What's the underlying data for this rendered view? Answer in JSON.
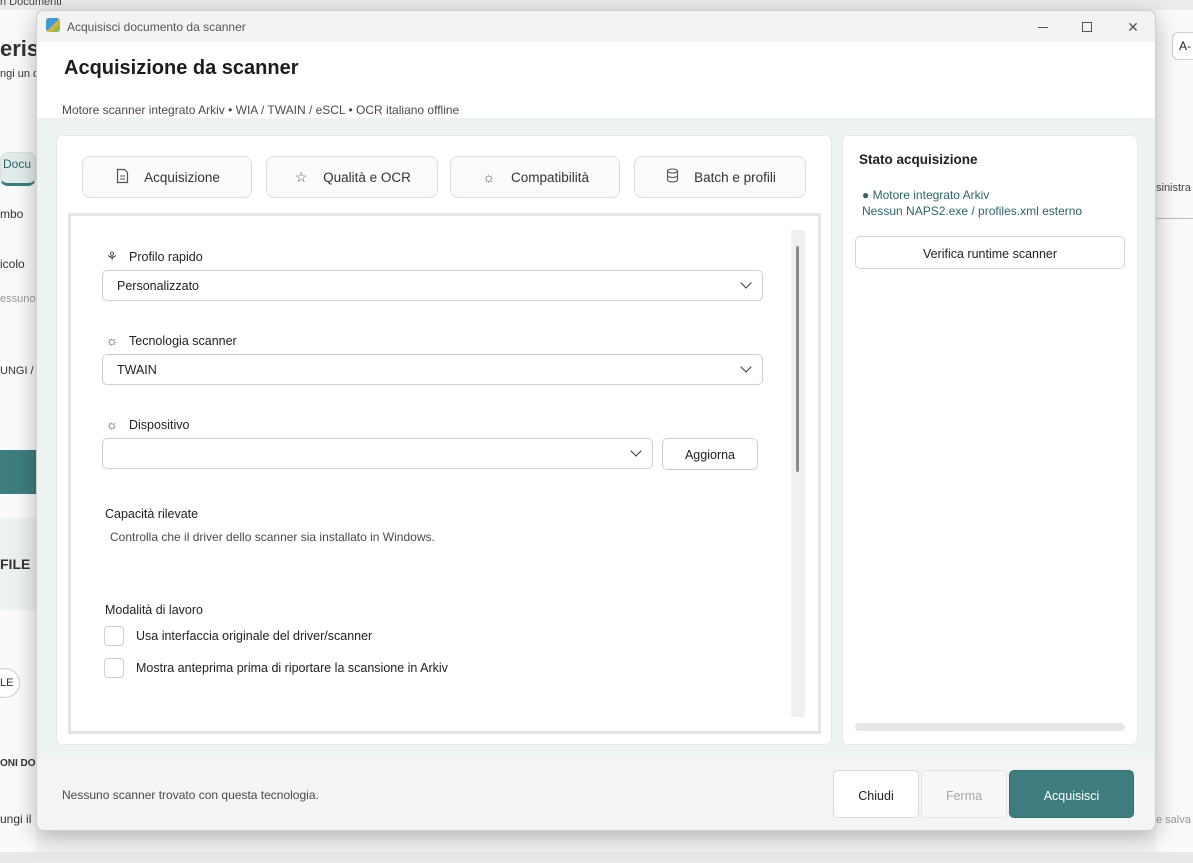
{
  "background": {
    "top_text": "ri Documenti",
    "left_fragments": [
      "eris",
      "ngi un d",
      "Docu",
      "mbo",
      "icolo",
      "essuno",
      "UNGI /",
      "FILE",
      "LE",
      "ONI DO",
      "ungi il"
    ],
    "right_fragments": [
      "A-",
      "sinistra",
      "e salva"
    ]
  },
  "window": {
    "title": "Acquisisci documento da scanner"
  },
  "header": {
    "title": "Acquisizione da scanner",
    "subtitle": "Motore scanner integrato Arkiv • WIA / TWAIN / eSCL • OCR italiano offline"
  },
  "tabs": [
    {
      "label": "Acquisizione",
      "icon": "document-icon"
    },
    {
      "label": "Qualità e OCR",
      "icon": "star-icon"
    },
    {
      "label": "Compatibilità",
      "icon": "sun-icon"
    },
    {
      "label": "Batch e profili",
      "icon": "database-icon"
    }
  ],
  "form": {
    "quick_profile": {
      "label": "Profilo rapido",
      "value": "Personalizzato"
    },
    "technology": {
      "label": "Tecnologia scanner",
      "value": "TWAIN"
    },
    "device": {
      "label": "Dispositivo",
      "value": "",
      "refresh_label": "Aggiorna"
    },
    "capabilities": {
      "title": "Capacità rilevate",
      "hint": "Controlla che il driver dello scanner sia installato in Windows."
    },
    "work_mode": {
      "title": "Modalità di lavoro",
      "options": [
        {
          "label": "Usa interfaccia originale del driver/scanner",
          "checked": false
        },
        {
          "label": "Mostra anteprima prima di riportare la scansione in Arkiv",
          "checked": false
        }
      ]
    }
  },
  "status_panel": {
    "title": "Stato acquisizione",
    "line1": "● Motore integrato Arkiv",
    "line2": "Nessun NAPS2.exe / profiles.xml esterno",
    "verify_label": "Verifica runtime scanner"
  },
  "footer": {
    "message": "Nessuno scanner trovato con questa tecnologia.",
    "close_label": "Chiudi",
    "stop_label": "Ferma",
    "acquire_label": "Acquisisci"
  },
  "colors": {
    "accent": "#3d7d80",
    "status_text": "#2f6466",
    "body_bg": "#edf3f3"
  }
}
